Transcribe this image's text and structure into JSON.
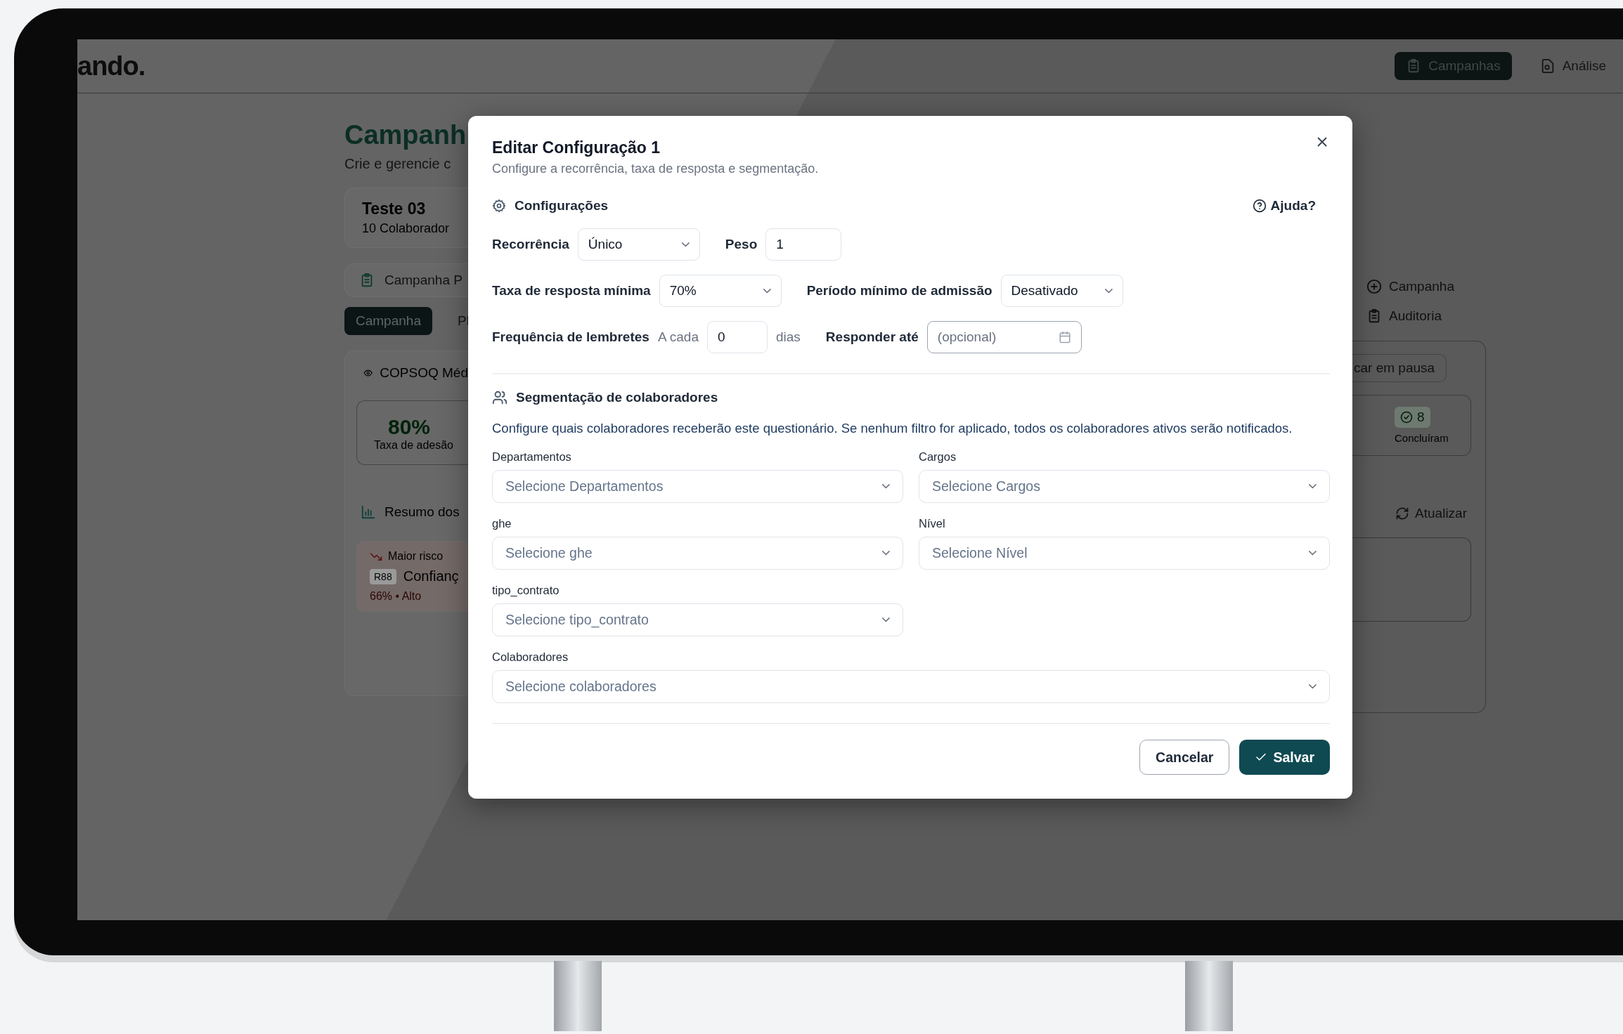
{
  "app_header": {
    "logo": "ando.",
    "nav": [
      {
        "label": "Campanhas",
        "kind": "campaigns",
        "selected": true
      },
      {
        "label": "Análise",
        "kind": "analysis",
        "selected": false
      }
    ]
  },
  "background_left": {
    "title": "Campanh",
    "subtitle": "Crie e gerencie c",
    "campaign_card": {
      "name": "Teste 03",
      "count": "10 Colaborador"
    },
    "section_label": "Campanha P",
    "tabs": [
      {
        "label": "Campanha",
        "selected": true
      },
      {
        "label": "Pl",
        "selected": false
      }
    ],
    "questionnaire": "COPSOQ Méd",
    "stat": {
      "value": "80%",
      "label": "Taxa de adesão"
    },
    "summary_title": "Resumo dos",
    "risk": {
      "label": "Maior risco",
      "code": "R88",
      "name": "Confianç",
      "score": "66% • Alto"
    }
  },
  "background_right": {
    "actions": [
      {
        "kind": "add",
        "label": "Campanha"
      },
      {
        "kind": "audit",
        "label": "Auditoria"
      }
    ],
    "pause_button": "car em pausa",
    "stat": {
      "value": "8",
      "label": "Concluíram"
    },
    "refresh": "Atualizar"
  },
  "modal": {
    "title": "Editar Configuração 1",
    "subtitle": "Configure a recorrência, taxa de resposta e segmentação.",
    "settings_title": "Configurações",
    "help": "Ajuda?",
    "rows": [
      {
        "fields": [
          {
            "kind": "select",
            "label": "Recorrência",
            "value": "Único"
          },
          {
            "kind": "input",
            "label": "Peso",
            "value": "1"
          }
        ]
      },
      {
        "fields": [
          {
            "kind": "select",
            "label": "Taxa de resposta mínima",
            "value": "70%"
          },
          {
            "kind": "select",
            "label": "Período mínimo de admissão",
            "value": "Desativado"
          }
        ]
      },
      {
        "fields": [
          {
            "kind": "input",
            "label": "Frequência de lembretes",
            "prefix": "A cada",
            "value": "0",
            "suffix": "dias"
          },
          {
            "kind": "date",
            "label": "Responder até",
            "placeholder": "(opcional)"
          }
        ]
      }
    ],
    "segmentation_title": "Segmentação de colaboradores",
    "segmentation_note": "Configure quais colaboradores receberão este questionário. Se nenhum filtro for aplicado, todos os colaboradores ativos serão notificados.",
    "filters": [
      {
        "label": "Departamentos",
        "placeholder": "Selecione Departamentos"
      },
      {
        "label": "Cargos",
        "placeholder": "Selecione Cargos"
      },
      {
        "label": "ghe",
        "placeholder": "Selecione ghe"
      },
      {
        "label": "Nível",
        "placeholder": "Selecione Nível"
      },
      {
        "label": "tipo_contrato",
        "placeholder": "Selecione tipo_contrato"
      }
    ],
    "collaborators": {
      "label": "Colaboradores",
      "placeholder": "Selecione colaboradores"
    },
    "buttons": [
      {
        "kind": "secondary",
        "label": "Cancelar"
      },
      {
        "kind": "primary",
        "label": "Salvar"
      }
    ]
  }
}
